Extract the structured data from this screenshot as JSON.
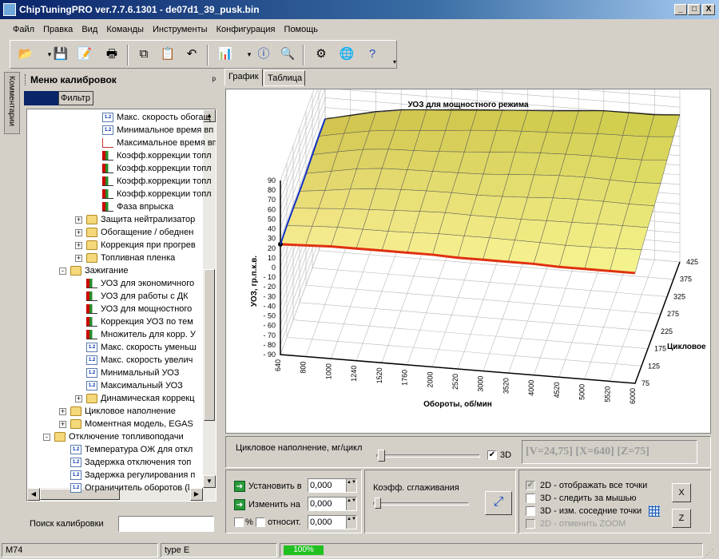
{
  "window": {
    "title": "ChipTuningPRO ver.7.7.6.1301 - de07d1_39_pusk.bin",
    "btn_min": "_",
    "btn_max": "□",
    "btn_close": "X"
  },
  "menu": [
    "Файл",
    "Правка",
    "Вид",
    "Команды",
    "Инструменты",
    "Конфигурация",
    "Помощь"
  ],
  "toolbar": {
    "icons": [
      "open-folder-icon",
      "save-icon",
      "save-as-icon",
      "print-icon",
      "copy-icon",
      "paste-icon",
      "undo-icon",
      "chart-icon",
      "info-icon",
      "compare-icon",
      "settings-icon",
      "internet-icon",
      "help-icon"
    ]
  },
  "side_tab": "Комментарии",
  "left_panel": {
    "title": "Меню калибровок",
    "pin": "ᵖ",
    "tab_active": "",
    "filter_tab": "Фильтр",
    "search_label": "Поиск калибровки",
    "search_value": "",
    "tree": [
      {
        "level": 4,
        "icon": "ic12",
        "label": "Макс. скорость обогащ"
      },
      {
        "level": 4,
        "icon": "ic12",
        "label": "Минимальное время вп"
      },
      {
        "level": 4,
        "icon": "icgraph2",
        "label": "Максимальное время вп"
      },
      {
        "level": 4,
        "icon": "icgraph",
        "label": "Коэфф.коррекции топл"
      },
      {
        "level": 4,
        "icon": "icgraph",
        "label": "Коэфф.коррекции топл"
      },
      {
        "level": 4,
        "icon": "icgraph",
        "label": "Коэфф.коррекции топл"
      },
      {
        "level": 4,
        "icon": "icgraph",
        "label": "Коэфф.коррекции топл"
      },
      {
        "level": 4,
        "icon": "icgraph",
        "label": "Фаза впрыска"
      },
      {
        "level": 3,
        "icon": "icfold",
        "label": "Защита нейтрализатор",
        "pm": "+"
      },
      {
        "level": 3,
        "icon": "icfold",
        "label": "Обогащение / обеднен",
        "pm": "+"
      },
      {
        "level": 3,
        "icon": "icfold",
        "label": "Коррекция при прогрев",
        "pm": "+"
      },
      {
        "level": 3,
        "icon": "icfold",
        "label": "Топливная пленка",
        "pm": "+"
      },
      {
        "level": 2,
        "icon": "icfold",
        "label": "Зажигание",
        "pm": "-"
      },
      {
        "level": 3,
        "icon": "icgraph",
        "label": "УОЗ для экономичного"
      },
      {
        "level": 3,
        "icon": "icgraph",
        "label": "УОЗ для работы с ДК"
      },
      {
        "level": 3,
        "icon": "icgraph",
        "label": "УОЗ для мощностного"
      },
      {
        "level": 3,
        "icon": "icgraph",
        "label": "Коррекция УОЗ по тем"
      },
      {
        "level": 3,
        "icon": "icgraph",
        "label": "Множитель для корр. У"
      },
      {
        "level": 3,
        "icon": "ic12",
        "label": "Макс. скорость уменьш"
      },
      {
        "level": 3,
        "icon": "ic12",
        "label": "Макс. скорость увелич"
      },
      {
        "level": 3,
        "icon": "ic12",
        "label": "Минимальный УОЗ"
      },
      {
        "level": 3,
        "icon": "ic12",
        "label": "Максимальный УОЗ"
      },
      {
        "level": 3,
        "icon": "icfold",
        "label": "Динамическая коррекц",
        "pm": "+"
      },
      {
        "level": 2,
        "icon": "icfold",
        "label": "Цикловое наполнение",
        "pm": "+"
      },
      {
        "level": 2,
        "icon": "icfold",
        "label": "Моментная модель, EGAS",
        "pm": "+"
      },
      {
        "level": 1,
        "icon": "icfold",
        "label": "Отключение топливоподачи",
        "pm": "-"
      },
      {
        "level": 2,
        "icon": "ic12",
        "label": "Температура ОЖ для откл"
      },
      {
        "level": 2,
        "icon": "ic12",
        "label": "Задержка отключения топ"
      },
      {
        "level": 2,
        "icon": "ic12",
        "label": "Задержка регулирования п"
      },
      {
        "level": 2,
        "icon": "ic12",
        "label": "Ограничитель оборотов (l"
      }
    ]
  },
  "tabs": [
    "График",
    "Таблица"
  ],
  "chart_data": {
    "type": "surface3d",
    "title": "УОЗ для мощностного режима",
    "xlabel": "Обороты, об/мин",
    "ylabel": "УОЗ, гр.п.к.в.",
    "zlabel": "Цикловое",
    "x_ticks": [
      "640",
      "800",
      "1000",
      "1240",
      "1520",
      "1760",
      "2000",
      "2520",
      "3000",
      "3520",
      "4000",
      "4520",
      "5000",
      "5520",
      "6000"
    ],
    "z_ticks": [
      "75",
      "125",
      "175",
      "225",
      "275",
      "325",
      "375",
      "425"
    ],
    "y_ticks": [
      "90",
      "80",
      "70",
      "60",
      "50",
      "40",
      "30",
      "20",
      "10",
      "0",
      "- 10",
      "- 20",
      "- 30",
      "- 40",
      "- 50",
      "- 60",
      "- 70",
      "- 80",
      "- 90"
    ],
    "ylim": [
      -90,
      90
    ],
    "front_curve": [
      24,
      25,
      26,
      26,
      26,
      26,
      26,
      25,
      25,
      25,
      25,
      24,
      24,
      24,
      24
    ],
    "back_curve": [
      28,
      34,
      40,
      44,
      46,
      48,
      50,
      52,
      54,
      56,
      58,
      60,
      60,
      60,
      62
    ]
  },
  "controls": {
    "slider_label": "Цикловое наполнение, мг/цикл",
    "chk3d_label": "3D",
    "chk3d": "✔",
    "readout": "[V=24,75] [X=640] [Z=75]",
    "set_label": "Установить в",
    "set_value": "0,000",
    "change_label": "Изменить на",
    "change_value": "0,000",
    "pct_label": "%",
    "rel_label": "относит.",
    "rel_value": "0,000",
    "smooth_label": "Коэфф. сглаживания",
    "opt1": "2D - отображать все точки",
    "opt2": "3D - следить за мышью",
    "opt3": "3D - изм. соседние точки",
    "opt4": "2D - отменить ZOOM",
    "btn_x": "X",
    "btn_z": "Z",
    "spin_arrows": "▲▼"
  },
  "status": {
    "cell1": "M74",
    "cell2": "type E",
    "progress": "100%",
    "progress_value": 1.0
  }
}
